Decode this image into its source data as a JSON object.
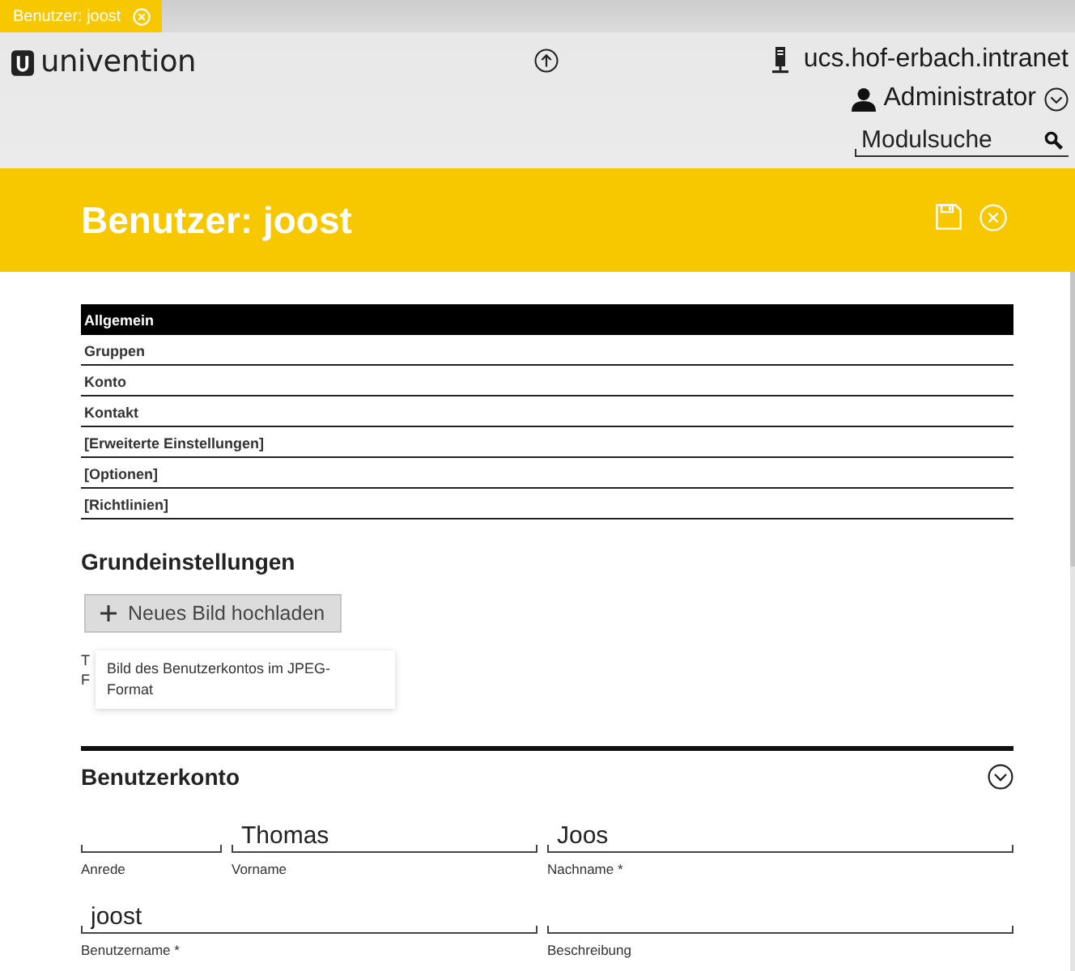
{
  "tab_bar": {
    "tabs": [
      {
        "label": "Benutzer: joost",
        "selected": true
      }
    ]
  },
  "header": {
    "logo": "univention",
    "host": "ucs.hof-erbach.intranet",
    "user": "Administrator",
    "search": {
      "placeholder": "Modulsuche"
    }
  },
  "module": {
    "title": "Benutzer: joost"
  },
  "section_tabs": [
    {
      "label": "Allgemein",
      "selected": true
    },
    {
      "label": "Gruppen",
      "selected": false
    },
    {
      "label": "Konto",
      "selected": false
    },
    {
      "label": "Kontakt",
      "selected": false
    },
    {
      "label": "[Erweiterte Einstellungen]",
      "selected": false
    },
    {
      "label": "[Optionen]",
      "selected": false
    },
    {
      "label": "[Richtlinien]",
      "selected": false
    }
  ],
  "grundeinstellungen": {
    "heading": "Grundeinstellungen",
    "upload_button": "Neues Bild hochladen",
    "covered_text": [
      "T",
      "F"
    ],
    "tooltip": "Bild des Benutzerkontos im JPEG-Format"
  },
  "benutzerkonto": {
    "heading": "Benutzerkonto",
    "expanded": true,
    "fields": [
      {
        "label": "Anrede"
      },
      {
        "label": "Vorname",
        "value": "Thomas"
      },
      {
        "label": "Nachname *",
        "value": "Joos"
      },
      {
        "label": "Benutzername *",
        "value": "joost"
      },
      {
        "label": "Beschreibung"
      }
    ]
  }
}
